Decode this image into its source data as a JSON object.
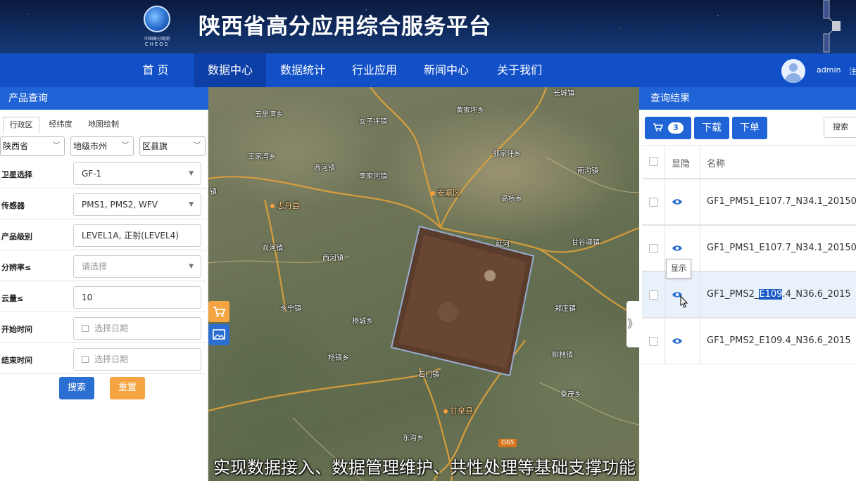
{
  "header": {
    "title": "陕西省高分应用综合服务平台",
    "logo_cn": "中国高分观测",
    "logo_en": "CHEOS"
  },
  "nav": {
    "items": [
      "首 页",
      "数据中心",
      "数据统计",
      "行业应用",
      "新闻中心",
      "关于我们"
    ],
    "active": "数据中心",
    "username": "admin",
    "logout": "注"
  },
  "left": {
    "title": "产品查询",
    "tabs": [
      "行政区",
      "经纬度",
      "地图绘制"
    ],
    "province": "陕西省",
    "city": "地级市州",
    "county": "区县旗",
    "fields": [
      {
        "label": "卫星选择",
        "value": "GF-1"
      },
      {
        "label": "传感器",
        "value": "PMS1, PMS2, WFV"
      },
      {
        "label": "产品级别",
        "value": "LEVEL1A, 正射(LEVEL4)"
      },
      {
        "label": "分辨率≤",
        "value": "请选择"
      },
      {
        "label": "云量≤",
        "value": "10"
      },
      {
        "label": "开始时间",
        "value": "选择日期"
      },
      {
        "label": "结束时间",
        "value": "选择日期"
      }
    ],
    "search_label": "搜索",
    "reset_label": "重置",
    "search_color": "#2b6fd1",
    "reset_color": "#f5a442"
  },
  "map": {
    "places": [
      {
        "name": "五里湾乡"
      },
      {
        "name": "女子坪镇"
      },
      {
        "name": "黄家坪乡"
      },
      {
        "name": "长城镇"
      },
      {
        "name": "郭家坪乡"
      },
      {
        "name": "西河镇"
      },
      {
        "name": "王家湾乡"
      },
      {
        "name": "李家河镇"
      },
      {
        "name": "高桥乡"
      },
      {
        "name": "双河镇"
      },
      {
        "name": "西河镇"
      },
      {
        "name": "永宁镇"
      },
      {
        "name": "杨城乡"
      },
      {
        "name": "甘谷驿镇"
      },
      {
        "name": "郑庄镇"
      },
      {
        "name": "杨镇乡"
      },
      {
        "name": "石门镇"
      },
      {
        "name": "东沟乡"
      },
      {
        "name": "桑茂乡"
      },
      {
        "name": "柳林镇"
      },
      {
        "name": "南沟镇"
      },
      {
        "name": "镇"
      }
    ],
    "cities": [
      "安塞区",
      "志丹县",
      "延河",
      "甘泉县"
    ],
    "road_badge": "G65"
  },
  "right": {
    "title": "查询结果",
    "cart_count": "3",
    "download_label": "下载",
    "order_label": "下单",
    "search_label": "搜索",
    "col_visible": "显隐",
    "col_name": "名称",
    "rows": [
      {
        "pre": "",
        "hl": "",
        "name": "GF1_PMS1_E107.7_N34.1_20150"
      },
      {
        "pre": "",
        "hl": "",
        "name": "GF1_PMS1_E107.7_N34.1_20150"
      },
      {
        "pre": "GF1_PMS2_",
        "hl": "E109",
        "name": ".4_N36.6_2015"
      },
      {
        "pre": "",
        "hl": "",
        "name": "GF1_PMS2_E109.4_N36.6_2015"
      }
    ],
    "tooltip": "显示"
  },
  "subtitle": "实现数据接入、数据管理维护、共性处理等基础支撑功能",
  "colors": {
    "nav_bg": "#1250c8",
    "panel_head": "#1f63d6",
    "map_tool_cart": "#f5a442",
    "map_tool_img": "#2b6fd1"
  },
  "icons": [
    "cart-icon",
    "image-icon",
    "eye-icon",
    "user-avatar-icon",
    "dropdown-arrow-icon",
    "calendar-icon",
    "expand-chevron-icon"
  ]
}
